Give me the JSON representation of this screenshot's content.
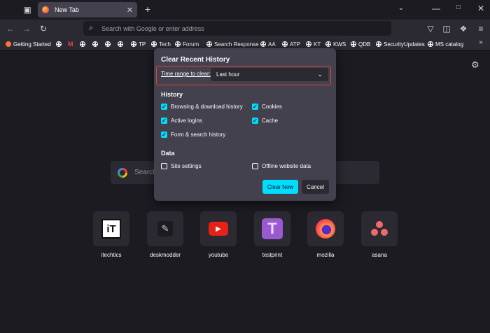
{
  "tab": {
    "title": "New Tab"
  },
  "urlbar": {
    "placeholder": "Search with Google or enter address"
  },
  "bookmarks": [
    {
      "label": "Getting Started",
      "icon": "firefox-icon"
    },
    {
      "label": "",
      "icon": "gmail-icon"
    },
    {
      "label": "",
      "icon": "globe-icon"
    },
    {
      "label": "",
      "icon": "globe-icon"
    },
    {
      "label": "",
      "icon": "globe-icon"
    },
    {
      "label": "",
      "icon": "globe-icon"
    },
    {
      "label": "TP",
      "icon": "globe-icon"
    },
    {
      "label": "Tech",
      "icon": "globe-icon"
    },
    {
      "label": "Forum",
      "icon": "globe-icon"
    },
    {
      "label": "Search Response",
      "icon": "globe-icon"
    },
    {
      "label": "AA",
      "icon": "globe-icon"
    },
    {
      "label": "ATP",
      "icon": "globe-icon"
    },
    {
      "label": "KT",
      "icon": "globe-icon"
    },
    {
      "label": "KWS",
      "icon": "globe-icon"
    },
    {
      "label": "QDB",
      "icon": "globe-icon"
    },
    {
      "label": "SecurityUpdates",
      "icon": "globe-icon"
    },
    {
      "label": "MS catalog",
      "icon": "globe-icon"
    }
  ],
  "search": {
    "placeholder": "Search"
  },
  "top_sites": [
    {
      "label": "itechtics",
      "icon": "itechtics-icon"
    },
    {
      "label": "deskmodder",
      "icon": "pen-icon"
    },
    {
      "label": "youtube",
      "icon": "youtube-icon"
    },
    {
      "label": "testprint",
      "icon": "testprint-icon"
    },
    {
      "label": "mozilla",
      "icon": "firefox-icon"
    },
    {
      "label": "asana",
      "icon": "asana-icon"
    }
  ],
  "dialog": {
    "title": "Clear Recent History",
    "time_range_label": "Time range to clear:",
    "time_range_value": "Last hour",
    "history_heading": "History",
    "history_items": [
      {
        "label": "Browsing & download history",
        "checked": true
      },
      {
        "label": "Cookies",
        "checked": true
      },
      {
        "label": "Active logins",
        "checked": true
      },
      {
        "label": "Cache",
        "checked": true
      },
      {
        "label": "Form & search history",
        "checked": true
      }
    ],
    "data_heading": "Data",
    "data_items": [
      {
        "label": "Site settings",
        "checked": false
      },
      {
        "label": "Offline website data",
        "checked": false
      }
    ],
    "clear_label": "Clear Now",
    "cancel_label": "Cancel"
  },
  "colors": {
    "accent": "#00ddff",
    "highlight": "#e0423e",
    "dialog_bg": "#42414d",
    "page_bg": "#1c1b22"
  }
}
